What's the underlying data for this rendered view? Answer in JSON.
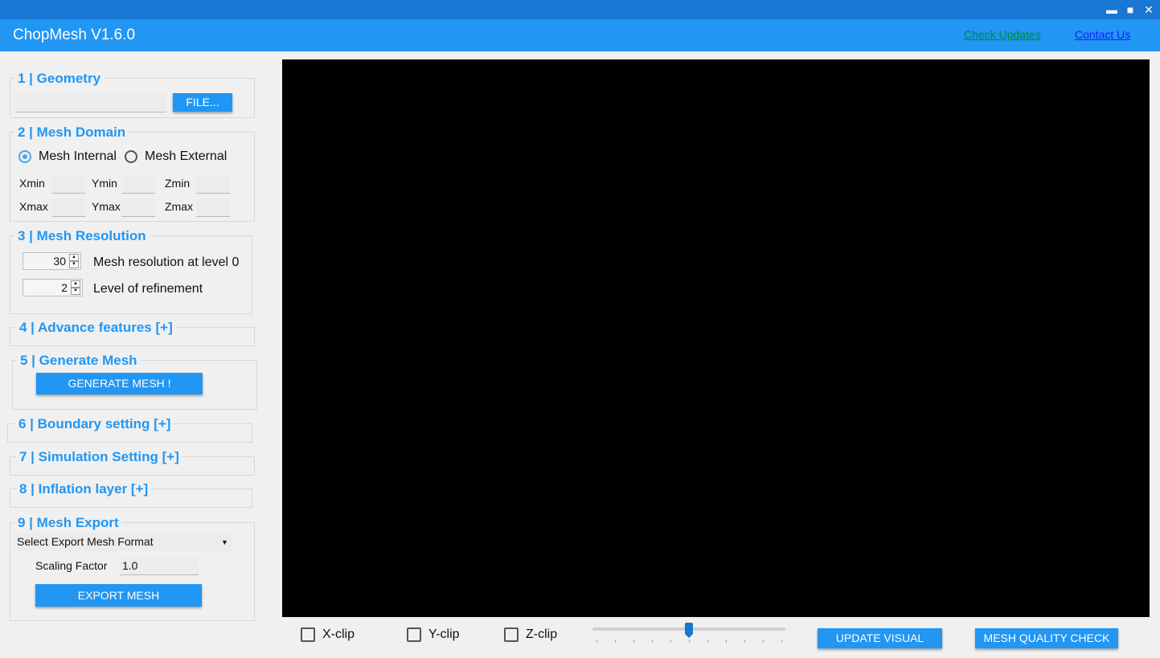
{
  "window": {
    "title": "ChopMesh V1.6.0",
    "minimize_glyph": "▬",
    "maximize_glyph": "■",
    "close_glyph": "✕",
    "links": {
      "check_updates": "Check Updates",
      "contact_us": "Contact Us"
    }
  },
  "geometry": {
    "title": "1 | Geometry",
    "file_value": "",
    "file_button": "FILE..."
  },
  "mesh_domain": {
    "title": "2 | Mesh Domain",
    "internal_label": "Mesh Internal",
    "external_label": "Mesh External",
    "selected": "internal",
    "bounds": [
      {
        "label": "Xmin",
        "value": ""
      },
      {
        "label": "Ymin",
        "value": ""
      },
      {
        "label": "Zmin",
        "value": ""
      },
      {
        "label": "Xmax",
        "value": ""
      },
      {
        "label": "Ymax",
        "value": ""
      },
      {
        "label": "Zmax",
        "value": ""
      }
    ]
  },
  "mesh_resolution": {
    "title": "3 | Mesh Resolution",
    "resolution_value": "30",
    "resolution_label": "Mesh resolution at level 0",
    "refinement_value": "2",
    "refinement_label": "Level of refinement"
  },
  "advance_features": {
    "title": "4 | Advance features [+]"
  },
  "generate_mesh": {
    "title": "5 | Generate Mesh",
    "button": "GENERATE MESH !"
  },
  "boundary_setting": {
    "title": "6 | Boundary setting [+]"
  },
  "simulation_setting": {
    "title": "7 | Simulation Setting [+]"
  },
  "inflation_layer": {
    "title": "8 | Inflation layer [+]"
  },
  "mesh_export": {
    "title": "9 | Mesh Export",
    "format_selected": "Select Export Mesh Format",
    "scaling_label": "Scaling Factor",
    "scaling_value": "1.0",
    "button": "EXPORT MESH"
  },
  "bottom_bar": {
    "xclip_label": "X-clip",
    "yclip_label": "Y-clip",
    "zclip_label": "Z-clip",
    "clip_slider_fraction": 0.5,
    "update_button": "UPDATE VISUAL",
    "quality_button": "MESH QUALITY CHECK"
  },
  "colors": {
    "accent": "#2196f3",
    "titlebar": "#1976d2",
    "link_updates": "#008a32",
    "link_contact": "#1a1aff",
    "viewport": "#000000"
  }
}
